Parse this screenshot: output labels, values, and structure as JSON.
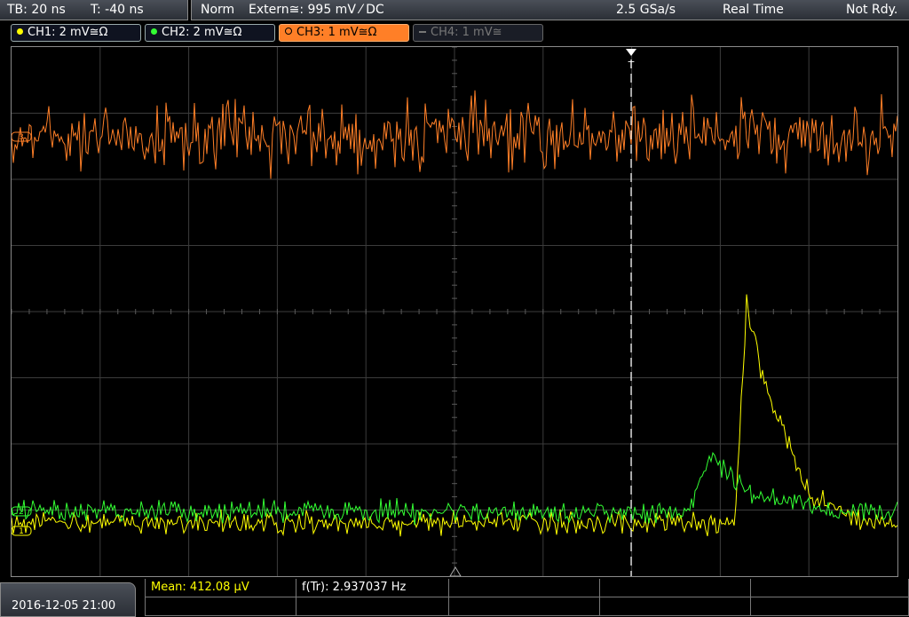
{
  "status": {
    "timebase": "TB: 20 ns",
    "trigger_time": "T: -40 ns",
    "trigger_mode": "Norm",
    "trigger_source": "Extern≅: 995 mV ⁄ DC",
    "sample_rate": "2.5 GSa/s",
    "acq_mode": "Real Time",
    "ready_state": "Not Rdy."
  },
  "channels": [
    {
      "label": "CH1: 2 mV≅Ω",
      "color": "#ffff00",
      "active": true
    },
    {
      "label": "CH2: 2 mV≅Ω",
      "color": "#33ff33",
      "active": true
    },
    {
      "label": "CH3: 1 mV≅Ω",
      "color": "#ff7f27",
      "active": true,
      "selected": true
    },
    {
      "label": "CH4: 1 mV≅",
      "color": "#8a8a8a",
      "active": false
    }
  ],
  "measurements": {
    "mean": "Mean: 412.08 µV",
    "freq": "f(Tr): 2.937037 Hz"
  },
  "datetime": "2016-12-05 21:00",
  "colors": {
    "ch1": "#ffff00",
    "ch2": "#33ff33",
    "ch3": "#ff7f27",
    "grid": "#4a4a4a",
    "panel": "#33373e"
  },
  "markers": {
    "trigger_icon": "T",
    "ch3_marker": "3",
    "ch2_marker": "2",
    "ch1_marker": "1"
  }
}
